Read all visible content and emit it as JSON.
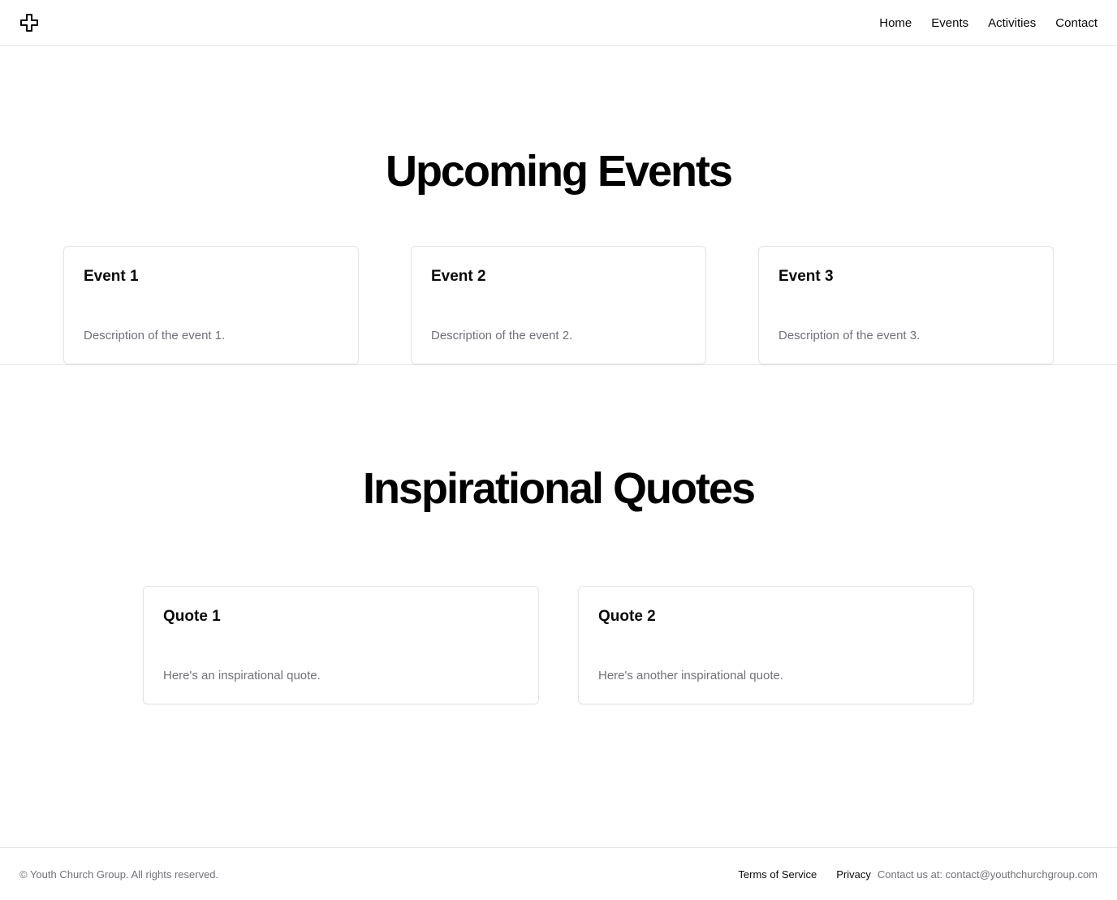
{
  "header": {
    "logo_icon": "cross-icon",
    "nav": [
      "Home",
      "Events",
      "Activities",
      "Contact"
    ]
  },
  "events": {
    "title": "Upcoming Events",
    "cards": [
      {
        "title": "Event 1",
        "description": "Description of the event 1."
      },
      {
        "title": "Event 2",
        "description": "Description of the event 2."
      },
      {
        "title": "Event 3",
        "description": "Description of the event 3."
      }
    ]
  },
  "quotes": {
    "title": "Inspirational Quotes",
    "cards": [
      {
        "title": "Quote 1",
        "description": "Here's an inspirational quote."
      },
      {
        "title": "Quote 2",
        "description": "Here's another inspirational quote."
      }
    ]
  },
  "footer": {
    "copyright": "© Youth Church Group. All rights reserved.",
    "terms": "Terms of Service",
    "privacy": "Privacy",
    "contact": "Contact us at: contact@youthchurchgroup.com"
  },
  "colors": {
    "text": "#09090b",
    "muted": "#71717a",
    "border": "#e4e4e7"
  }
}
